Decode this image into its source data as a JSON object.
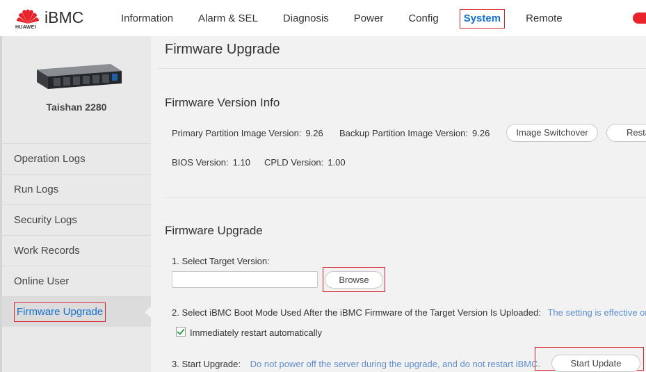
{
  "app": {
    "brand": "iBMC",
    "vendor": "HUAWEI"
  },
  "nav": {
    "items": [
      {
        "label": "Information"
      },
      {
        "label": "Alarm & SEL"
      },
      {
        "label": "Diagnosis"
      },
      {
        "label": "Power"
      },
      {
        "label": "Config"
      },
      {
        "label": "System",
        "active": true
      },
      {
        "label": "Remote"
      }
    ]
  },
  "sidebar": {
    "server_name": "Taishan 2280",
    "items": [
      {
        "label": "Operation Logs"
      },
      {
        "label": "Run Logs"
      },
      {
        "label": "Security Logs"
      },
      {
        "label": "Work Records"
      },
      {
        "label": "Online User"
      },
      {
        "label": "Firmware Upgrade",
        "active": true
      }
    ]
  },
  "main": {
    "page_title": "Firmware Upgrade",
    "version_info": {
      "title": "Firmware Version Info",
      "primary_label": "Primary Partition Image Version:",
      "primary_value": "9.26",
      "backup_label": "Backup Partition Image Version:",
      "backup_value": "9.26",
      "switchover_button": "Image Switchover",
      "restart_button": "Resta",
      "bios_label": "BIOS Version:",
      "bios_value": "1.10",
      "cpld_label": "CPLD Version:",
      "cpld_value": "1.00"
    },
    "upgrade": {
      "title": "Firmware Upgrade",
      "step1_label": "1. Select Target Version:",
      "file_value": "",
      "browse_button": "Browse",
      "step2_label": "2. Select iBMC Boot Mode Used After the iBMC Firmware of the Target Version Is Uploaded:",
      "step2_hint": "The setting is effective or",
      "restart_checkbox_label": "Immediately restart automatically",
      "restart_checked": true,
      "step3_label": "3. Start Upgrade:",
      "step3_hint": "Do not power off the server during the upgrade, and do not restart iBMC.",
      "start_button": "Start Update"
    }
  },
  "colors": {
    "accent": "#1470cc",
    "highlight": "#d9232c",
    "hint": "#5e8fcf",
    "power": "#e8232a"
  }
}
